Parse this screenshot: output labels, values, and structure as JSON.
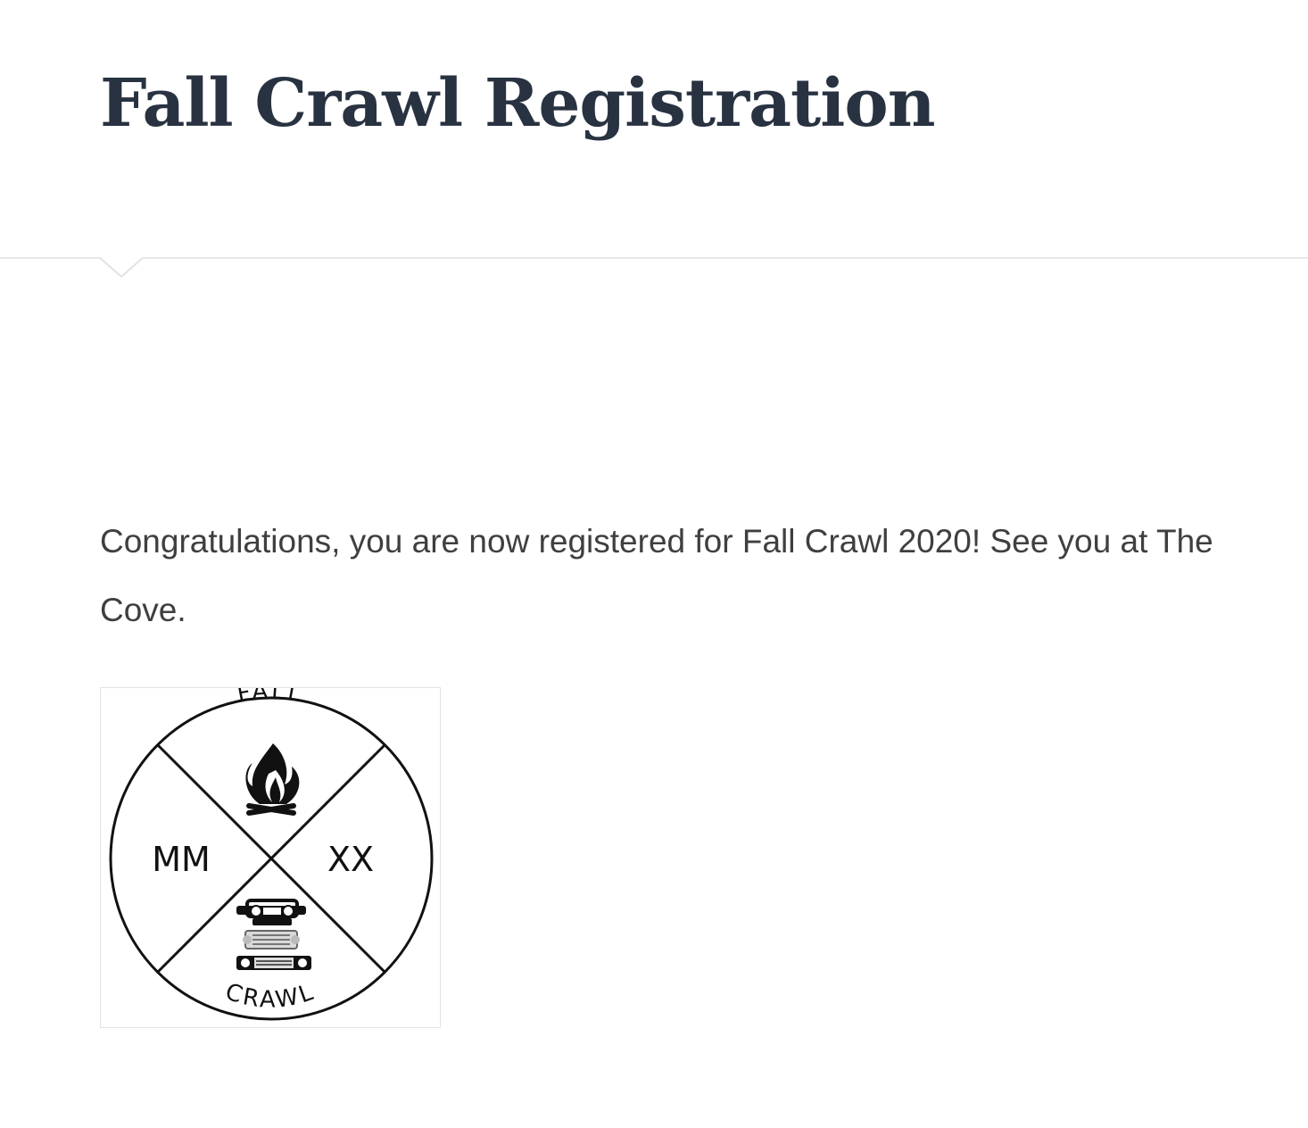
{
  "page": {
    "title": "Fall Crawl Registration"
  },
  "content": {
    "message": "Congratulations, you are now registered for Fall Crawl 2020! See you at The Cove."
  },
  "logo": {
    "top_text": "FALL",
    "bottom_text": "CRAWL",
    "left_text": "MM",
    "right_text": "XX",
    "icons": [
      "campfire-icon",
      "vehicle-fronts-icon"
    ]
  },
  "colors": {
    "title": "#283241",
    "body_text": "#3f3f3f",
    "divider": "#e8e8e8"
  }
}
